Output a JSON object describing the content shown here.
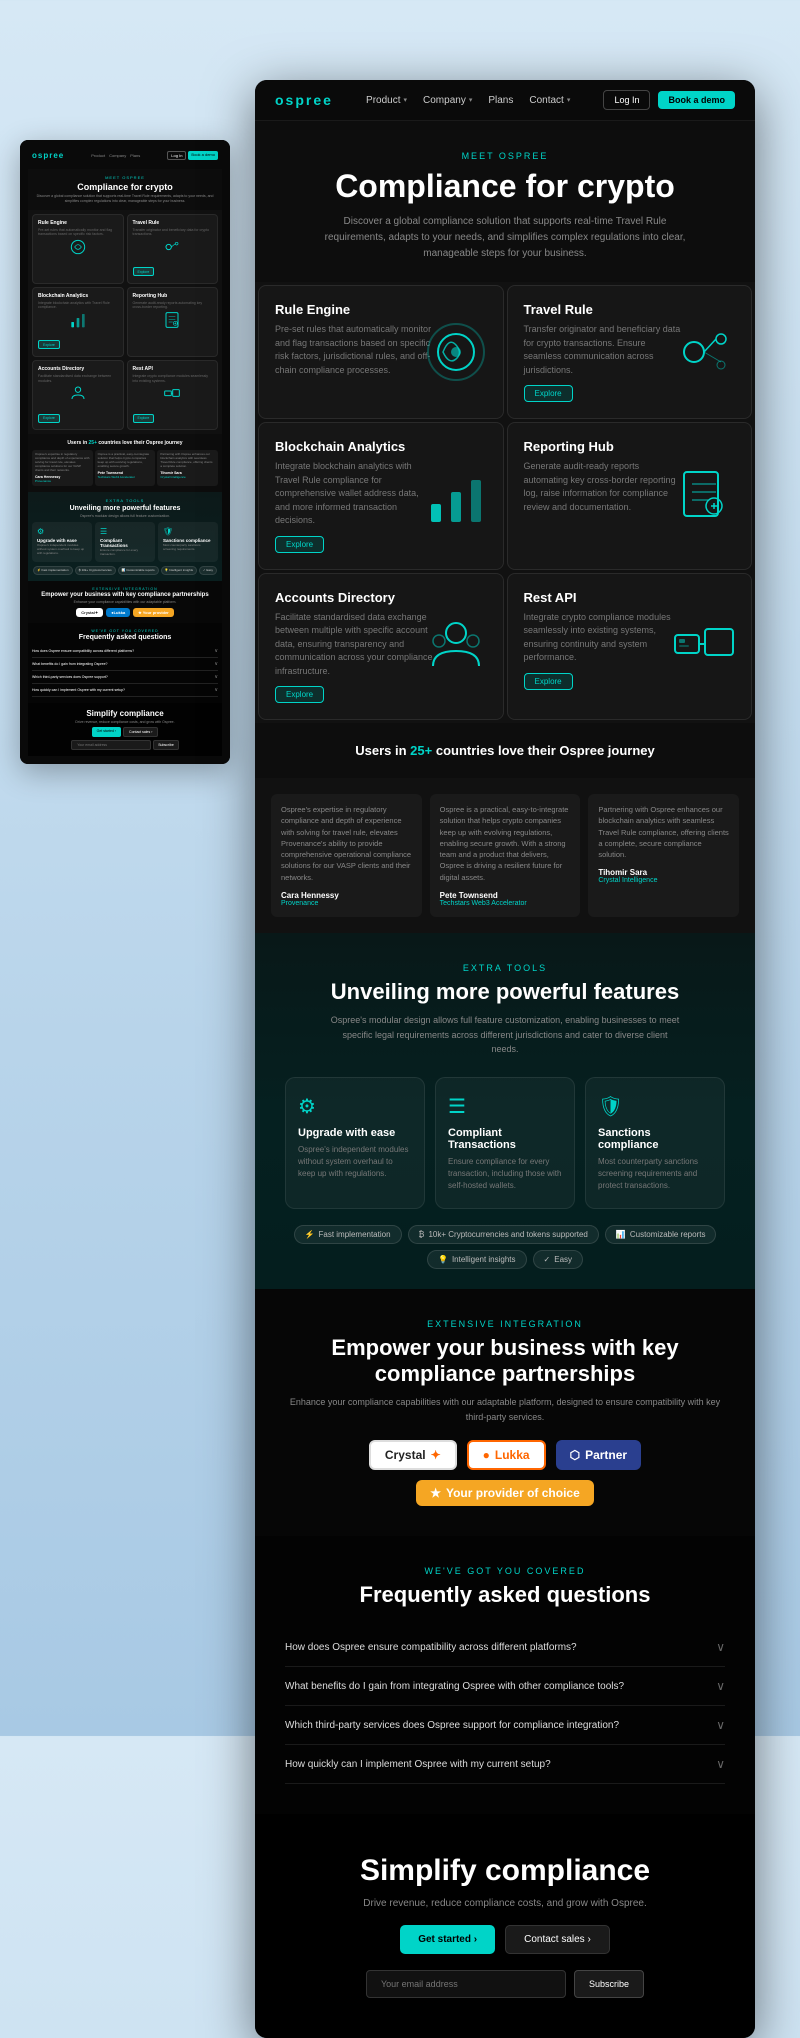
{
  "site": {
    "logo": "ospree",
    "nav": {
      "links": [
        {
          "label": "Product",
          "has_dropdown": true
        },
        {
          "label": "Company",
          "has_dropdown": true
        },
        {
          "label": "Plans",
          "has_dropdown": false
        },
        {
          "label": "Contact",
          "has_dropdown": true
        }
      ],
      "btn_login": "Log In",
      "btn_demo": "Book a demo"
    }
  },
  "hero": {
    "sub_label": "MEET OSPREE",
    "title": "Compliance for crypto",
    "description": "Discover a global compliance solution that supports real-time Travel Rule requirements, adapts to your needs, and simplifies complex regulations into clear, manageable steps for your business."
  },
  "products": [
    {
      "id": "rule-engine",
      "title": "Rule Engine",
      "description": "Pre-set rules that automatically monitor and flag transactions based on specific risk factors, jurisdictional rules, and off-chain compliance processes.",
      "has_explore": false
    },
    {
      "id": "travel-rule",
      "title": "Travel Rule",
      "description": "Transfer originator and beneficiary data for crypto transactions. Ensure seamless communication across jurisdictions.",
      "has_explore": true,
      "explore_label": "Explore"
    },
    {
      "id": "blockchain-analytics",
      "title": "Blockchain Analytics",
      "description": "Integrate blockchain analytics with Travel Rule compliance for comprehensive wallet address data, and more informed transaction decisions.",
      "has_explore": true,
      "explore_label": "Explore"
    },
    {
      "id": "reporting-hub",
      "title": "Reporting Hub",
      "description": "Generate audit-ready reports automating key cross-border reporting log, raise information for compliance review and documentation.",
      "has_explore": false
    },
    {
      "id": "accounts-directory",
      "title": "Accounts Directory",
      "description": "Facilitate standardised data exchange between multiple with specific account data, ensuring transparency and communication across your compliance infrastructure.",
      "has_explore": true,
      "explore_label": "Explore"
    },
    {
      "id": "rest-api",
      "title": "Rest API",
      "description": "Integrate crypto compliance modules seamlessly into existing systems, ensuring continuity and system performance.",
      "has_explore": true,
      "explore_label": "Explore"
    }
  ],
  "countries": {
    "text": "Users in ",
    "count": "25+",
    "suffix": " countries love their Ospree journey"
  },
  "testimonials": [
    {
      "text": "Ospree's expertise in regulatory compliance and depth of experience with solving for travel rule, elevates Provenance's ability to provide comprehensive operational compliance solutions for our VASP clients and their networks.",
      "author": "Cara Hennessy",
      "company": "Provenance"
    },
    {
      "text": "Ospree is a practical, easy-to-integrate solution that helps crypto companies keep up with evolving regulations, enabling secure growth. With a strong team and a product that delivers, Ospree is driving a resilient future for digital assets.",
      "author": "Pete Townsend",
      "company": "Techstars Web3 Accelerator"
    },
    {
      "text": "Partnering with Ospree enhances our blockchain analytics with seamless Travel Rule compliance, offering clients a complete, secure compliance solution.",
      "author": "Tihomir Sara",
      "company": "Crystal Intelligence"
    }
  ],
  "features": {
    "sub_label": "EXTRA TOOLS",
    "title": "Unveiling more powerful features",
    "description": "Ospree's modular design allows full feature customization, enabling businesses to meet specific legal requirements across different jurisdictions and cater to diverse client needs.",
    "cards": [
      {
        "icon": "⚙",
        "title": "Upgrade with ease",
        "description": "Ospree's independent modules without system overhaul to keep up with regulations."
      },
      {
        "icon": "☰",
        "title": "Compliant Transactions",
        "description": "Ensure compliance for every transaction, including those with self-hosted wallets."
      },
      {
        "icon": "🛡",
        "title": "Sanctions compliance",
        "description": "Most counterparty sanctions screening requirements and protect transactions."
      }
    ],
    "badges": [
      {
        "icon": "⚡",
        "label": "Fast implementation"
      },
      {
        "icon": "₿",
        "label": "10k+ Cryptocurrencies and tokens supported"
      },
      {
        "icon": "📊",
        "label": "Customizable reports"
      },
      {
        "icon": "💡",
        "label": "Intelligent insights"
      },
      {
        "icon": "✓",
        "label": "Easy"
      }
    ]
  },
  "integrations": {
    "sub_label": "EXTENSIVE INTEGRATION",
    "title": "Empower your business with key compliance partnerships",
    "description": "Enhance your compliance capabilities with our adaptable platform, designed to ensure compatibility with key third-party services.",
    "partners": [
      {
        "name": "Crystal",
        "suffix": "✦",
        "style": "crystal"
      },
      {
        "name": "●Lukka",
        "style": "lukka"
      },
      {
        "name": "partner3",
        "style": "blue-bg"
      },
      {
        "name": "Your provider of choice",
        "style": "gold-bg"
      }
    ]
  },
  "faq": {
    "sub_label": "WE'VE GOT YOU COVERED",
    "title": "Frequently asked questions",
    "items": [
      {
        "question": "How does Ospree ensure compatibility across different platforms?"
      },
      {
        "question": "What benefits do I gain from integrating Ospree with other compliance tools?"
      },
      {
        "question": "Which third-party services does Ospree support for compliance integration?"
      },
      {
        "question": "How quickly can I implement Ospree with my current setup?"
      }
    ]
  },
  "cta": {
    "title": "Simplify compliance",
    "description": "Drive revenue, reduce compliance costs, and grow with Ospree.",
    "btn_start": "Get started ›",
    "btn_contact": "Contact sales ›",
    "email_placeholder": "Your email address",
    "subscribe_label": "Subscribe"
  }
}
